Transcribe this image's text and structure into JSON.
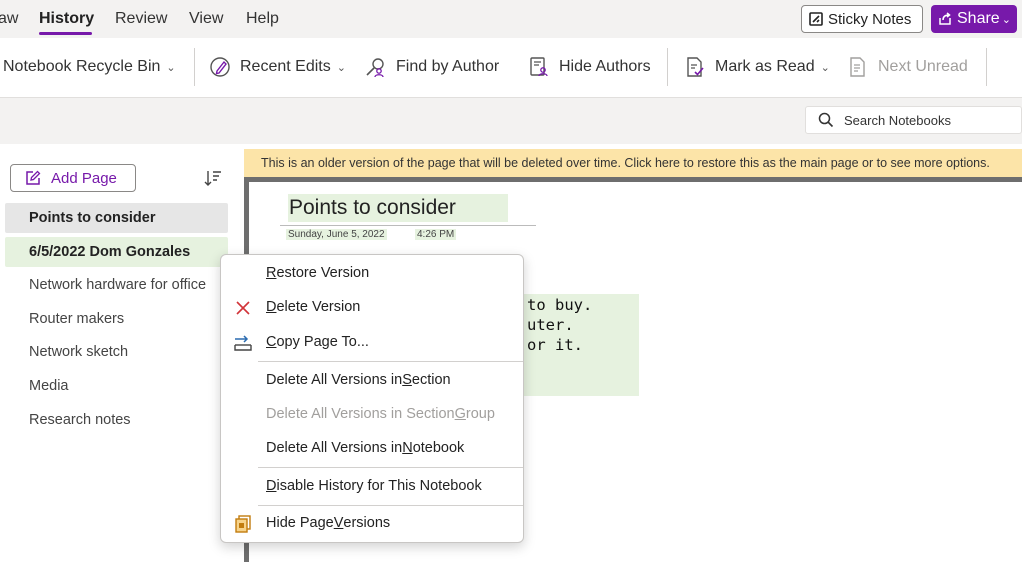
{
  "menubar": {
    "items": [
      "aw",
      "History",
      "Review",
      "View",
      "Help"
    ],
    "active": "History",
    "sticky_notes": "Sticky Notes",
    "share": "Share"
  },
  "ribbon": {
    "notebook_recycle_bin": "Notebook Recycle Bin",
    "recent_edits": "Recent Edits",
    "find_by_author": "Find by Author",
    "hide_authors": "Hide Authors",
    "mark_as_read": "Mark as Read",
    "next_unread": "Next Unread"
  },
  "search": {
    "placeholder": "Search Notebooks"
  },
  "sidebar": {
    "add_page": "Add Page",
    "pages": [
      {
        "label": "Points to consider",
        "state": "selected"
      },
      {
        "label": "6/5/2022 Dom Gonzales",
        "state": "version"
      },
      {
        "label": "Network hardware for office",
        "state": "normal"
      },
      {
        "label": "Router makers",
        "state": "normal"
      },
      {
        "label": "Network sketch",
        "state": "normal"
      },
      {
        "label": "Media",
        "state": "normal"
      },
      {
        "label": "Research notes",
        "state": "normal"
      }
    ]
  },
  "banner": "This is an older version of the page that will be deleted over time. Click here to restore this as the main page or to see more options.",
  "page": {
    "title": "Points to consider",
    "date": "Sunday, June 5, 2022",
    "time": "4:26 PM",
    "body_lines": [
      "to buy.",
      "uter.",
      "or it."
    ]
  },
  "context_menu": {
    "restore_version": {
      "pre": "",
      "key": "R",
      "post": "estore Version"
    },
    "delete_version": {
      "pre": "",
      "key": "D",
      "post": "elete Version"
    },
    "copy_page_to": {
      "pre": "",
      "key": "C",
      "post": "opy Page To..."
    },
    "delete_all_section": {
      "pre": "Delete All Versions in ",
      "key": "S",
      "post": "ection"
    },
    "delete_all_section_group": {
      "pre": "Delete All Versions in Section ",
      "key": "G",
      "post": "roup"
    },
    "delete_all_notebook": {
      "pre": "Delete All Versions in ",
      "key": "N",
      "post": "otebook"
    },
    "disable_history": {
      "pre": "",
      "key": "D",
      "post": "isable History for This Notebook"
    },
    "hide_page_versions": {
      "pre": "Hide Page ",
      "key": "V",
      "post": "ersions"
    }
  },
  "colors": {
    "accent": "#7719aa",
    "banner": "#fce4a8",
    "version_highlight": "#e6f2df",
    "delete_red": "#d13438"
  }
}
